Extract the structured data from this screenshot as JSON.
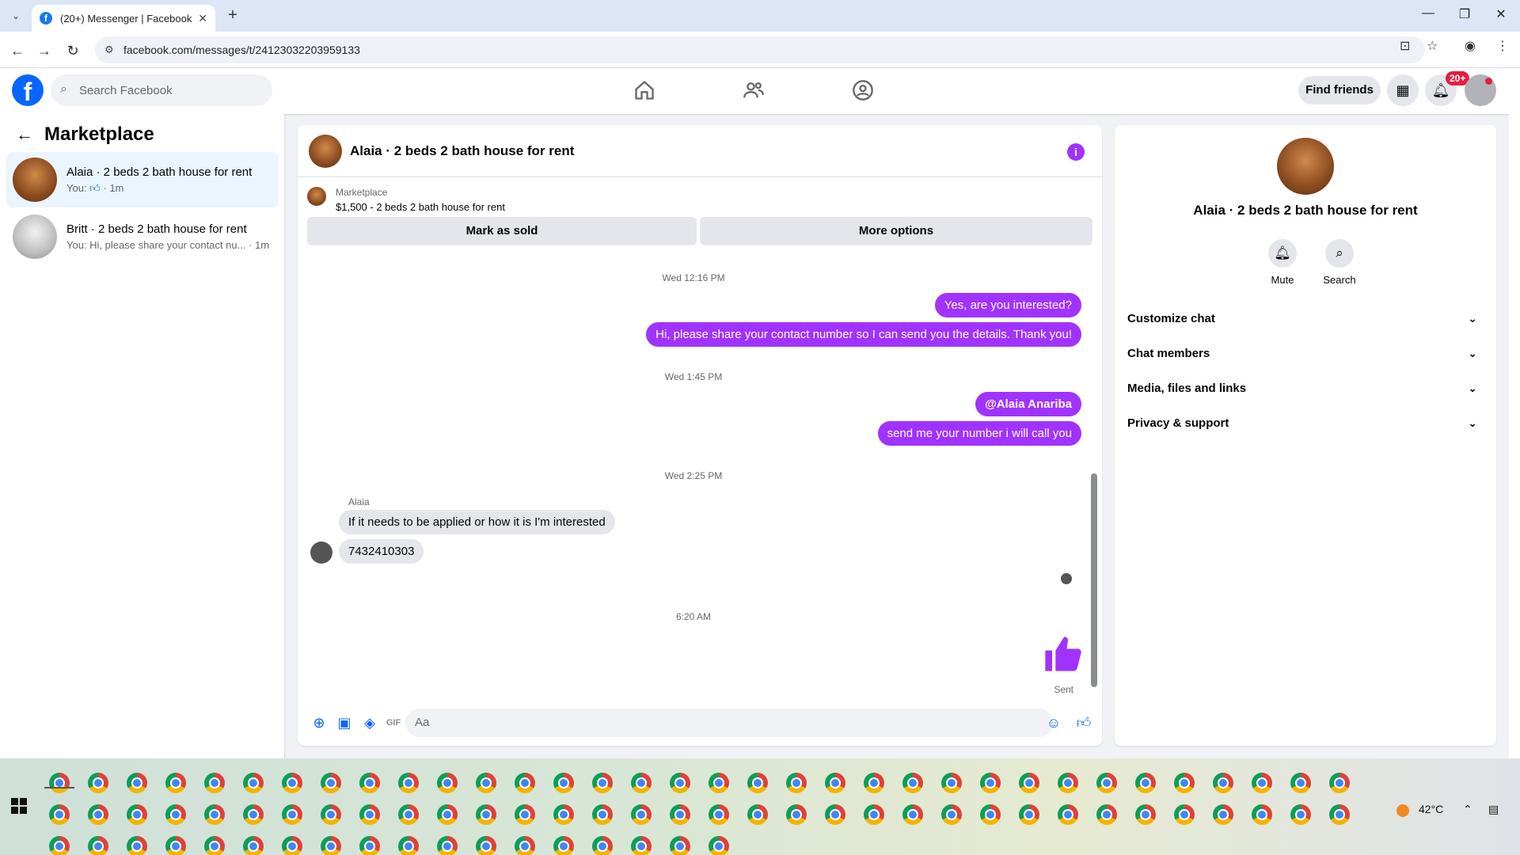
{
  "browser": {
    "tab_title": "(20+) Messenger | Facebook",
    "url": "facebook.com/messages/t/24123032203959133",
    "new_tab": "+",
    "tab_close": "✕",
    "minimize": "—",
    "restore": "❐",
    "close": "✕"
  },
  "fb_header": {
    "logo": "f",
    "search_placeholder": "Search Facebook",
    "find_friends": "Find friends",
    "notification_badge": "20+"
  },
  "sidebar": {
    "title": "Marketplace",
    "conversations": [
      {
        "name": "Alaia · 2 beds 2 bath house for rent",
        "preview_prefix": "You: ",
        "preview_suffix": " · 1m",
        "active": true
      },
      {
        "name": "Britt · 2 beds 2 bath house for rent",
        "preview": "You: Hi, please share your contact nu... · 1m",
        "active": false
      }
    ]
  },
  "chat": {
    "title": "Alaia · 2 beds 2 bath house for rent",
    "marketplace_label": "Marketplace",
    "listing": "$1,500 - 2 beds 2 bath house for rent",
    "mark_sold": "Mark as sold",
    "more_options": "More options",
    "messages": {
      "ts1": "Wed 12:16 PM",
      "out1": "Yes, are you interested?",
      "out2": "Hi, please share your contact number so I can send you the details. Thank you!",
      "ts2": "Wed 1:45 PM",
      "out3": "@Alaia Anariba",
      "out4": "send me your number i will call you",
      "ts3": "Wed 2:25 PM",
      "sender": "Alaia",
      "in1": "If it needs to be applied or how it is I'm interested",
      "in2": "7432410303",
      "ts4": "6:20 AM",
      "sent": "Sent"
    },
    "composer_placeholder": "Aa"
  },
  "info_panel": {
    "name": "Alaia · 2 beds 2 bath house for rent",
    "mute": "Mute",
    "search": "Search",
    "sections": [
      "Customize chat",
      "Chat members",
      "Media, files and links",
      "Privacy & support"
    ]
  },
  "taskbar": {
    "weather": "42°C"
  },
  "colors": {
    "accent": "#a033ff",
    "fb_blue": "#0866ff"
  }
}
